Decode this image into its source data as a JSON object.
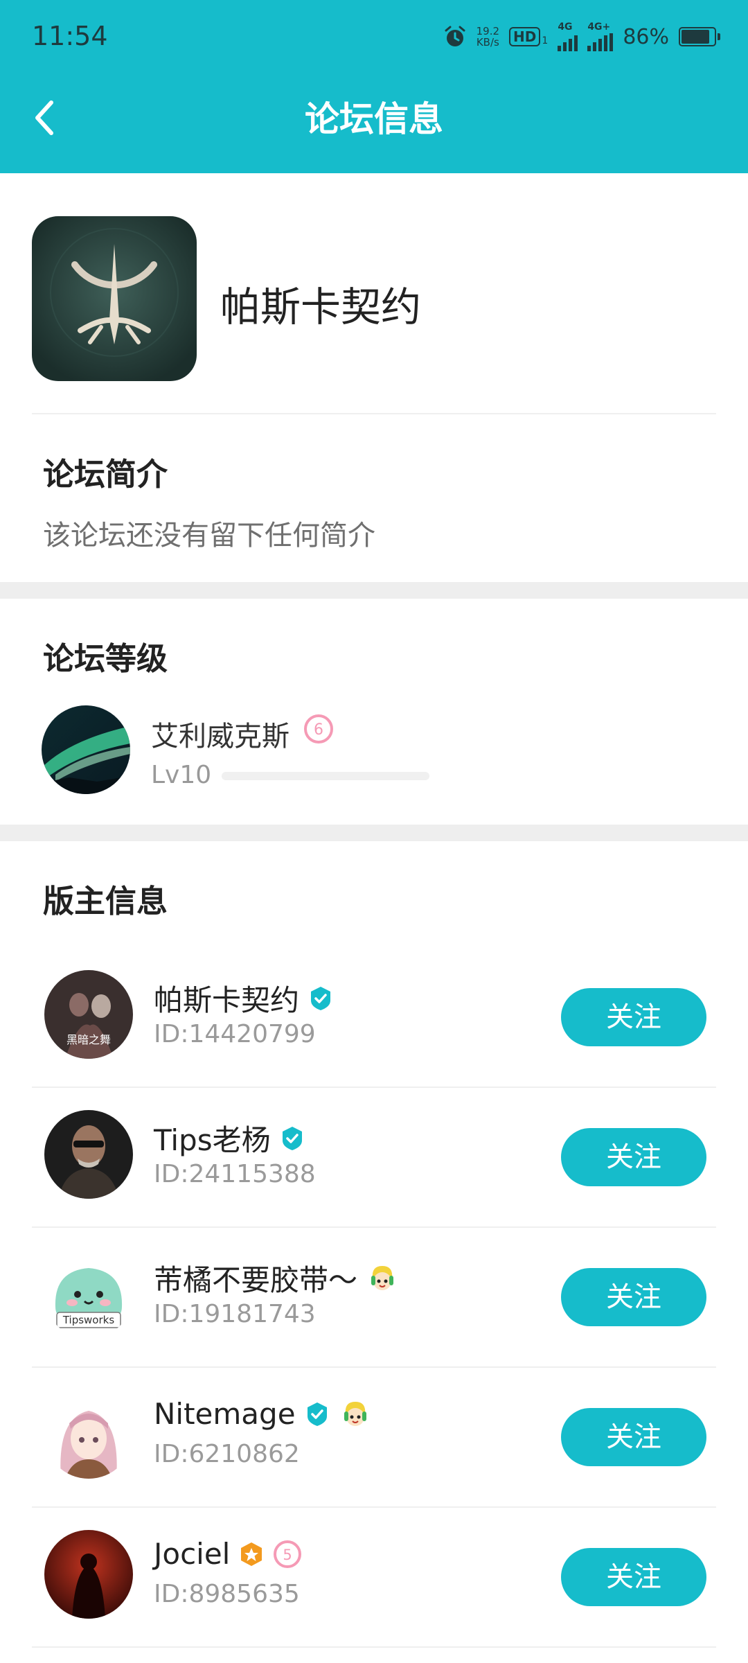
{
  "status_bar": {
    "time": "11:54",
    "net_speed_value": "19.2",
    "net_speed_unit": "KB/s",
    "hd_label": "HD",
    "hd_sub": "1",
    "signal1": "4G",
    "signal2": "4G+",
    "battery": "86%"
  },
  "header": {
    "title": "论坛信息",
    "back_icon": "chevron-left-icon"
  },
  "forum": {
    "name": "帕斯卡契约"
  },
  "intro": {
    "title": "论坛简介",
    "text": "该论坛还没有留下任何简介"
  },
  "level": {
    "title": "论坛等级",
    "user_name": "艾利威克斯",
    "badge": "6",
    "lv_text": "Lv10",
    "progress": 0
  },
  "moderators": {
    "title": "版主信息",
    "follow_label": "关注",
    "items": [
      {
        "name": "帕斯卡契约",
        "id": "ID:14420799",
        "avatar_text": "黑暗之舞"
      },
      {
        "name": "Tips老杨",
        "id": "ID:24115388"
      },
      {
        "name": "芾橘不要胶带～",
        "id": "ID:19181743",
        "avatar_text": "Tipsworks"
      },
      {
        "name": "Nitemage",
        "id": "ID:6210862"
      },
      {
        "name": "Jociel",
        "id": "ID:8985635",
        "badge": "5"
      }
    ]
  },
  "colors": {
    "accent": "#16BCCB",
    "verified": "#16BCCB",
    "level_badge": "#F59AB5",
    "gold_badge": "#F39A1E"
  }
}
